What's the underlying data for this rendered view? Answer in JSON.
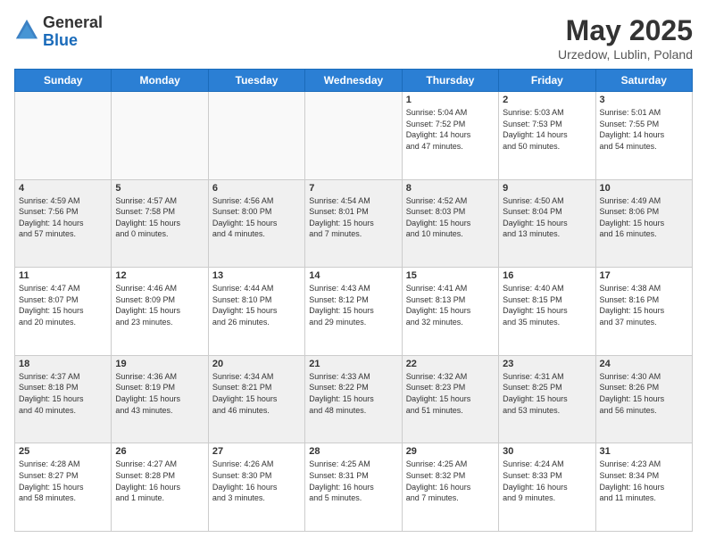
{
  "header": {
    "logo_general": "General",
    "logo_blue": "Blue",
    "month": "May 2025",
    "location": "Urzedow, Lublin, Poland"
  },
  "weekdays": [
    "Sunday",
    "Monday",
    "Tuesday",
    "Wednesday",
    "Thursday",
    "Friday",
    "Saturday"
  ],
  "weeks": [
    [
      {
        "day": "",
        "info": ""
      },
      {
        "day": "",
        "info": ""
      },
      {
        "day": "",
        "info": ""
      },
      {
        "day": "",
        "info": ""
      },
      {
        "day": "1",
        "info": "Sunrise: 5:04 AM\nSunset: 7:52 PM\nDaylight: 14 hours\nand 47 minutes."
      },
      {
        "day": "2",
        "info": "Sunrise: 5:03 AM\nSunset: 7:53 PM\nDaylight: 14 hours\nand 50 minutes."
      },
      {
        "day": "3",
        "info": "Sunrise: 5:01 AM\nSunset: 7:55 PM\nDaylight: 14 hours\nand 54 minutes."
      }
    ],
    [
      {
        "day": "4",
        "info": "Sunrise: 4:59 AM\nSunset: 7:56 PM\nDaylight: 14 hours\nand 57 minutes."
      },
      {
        "day": "5",
        "info": "Sunrise: 4:57 AM\nSunset: 7:58 PM\nDaylight: 15 hours\nand 0 minutes."
      },
      {
        "day": "6",
        "info": "Sunrise: 4:56 AM\nSunset: 8:00 PM\nDaylight: 15 hours\nand 4 minutes."
      },
      {
        "day": "7",
        "info": "Sunrise: 4:54 AM\nSunset: 8:01 PM\nDaylight: 15 hours\nand 7 minutes."
      },
      {
        "day": "8",
        "info": "Sunrise: 4:52 AM\nSunset: 8:03 PM\nDaylight: 15 hours\nand 10 minutes."
      },
      {
        "day": "9",
        "info": "Sunrise: 4:50 AM\nSunset: 8:04 PM\nDaylight: 15 hours\nand 13 minutes."
      },
      {
        "day": "10",
        "info": "Sunrise: 4:49 AM\nSunset: 8:06 PM\nDaylight: 15 hours\nand 16 minutes."
      }
    ],
    [
      {
        "day": "11",
        "info": "Sunrise: 4:47 AM\nSunset: 8:07 PM\nDaylight: 15 hours\nand 20 minutes."
      },
      {
        "day": "12",
        "info": "Sunrise: 4:46 AM\nSunset: 8:09 PM\nDaylight: 15 hours\nand 23 minutes."
      },
      {
        "day": "13",
        "info": "Sunrise: 4:44 AM\nSunset: 8:10 PM\nDaylight: 15 hours\nand 26 minutes."
      },
      {
        "day": "14",
        "info": "Sunrise: 4:43 AM\nSunset: 8:12 PM\nDaylight: 15 hours\nand 29 minutes."
      },
      {
        "day": "15",
        "info": "Sunrise: 4:41 AM\nSunset: 8:13 PM\nDaylight: 15 hours\nand 32 minutes."
      },
      {
        "day": "16",
        "info": "Sunrise: 4:40 AM\nSunset: 8:15 PM\nDaylight: 15 hours\nand 35 minutes."
      },
      {
        "day": "17",
        "info": "Sunrise: 4:38 AM\nSunset: 8:16 PM\nDaylight: 15 hours\nand 37 minutes."
      }
    ],
    [
      {
        "day": "18",
        "info": "Sunrise: 4:37 AM\nSunset: 8:18 PM\nDaylight: 15 hours\nand 40 minutes."
      },
      {
        "day": "19",
        "info": "Sunrise: 4:36 AM\nSunset: 8:19 PM\nDaylight: 15 hours\nand 43 minutes."
      },
      {
        "day": "20",
        "info": "Sunrise: 4:34 AM\nSunset: 8:21 PM\nDaylight: 15 hours\nand 46 minutes."
      },
      {
        "day": "21",
        "info": "Sunrise: 4:33 AM\nSunset: 8:22 PM\nDaylight: 15 hours\nand 48 minutes."
      },
      {
        "day": "22",
        "info": "Sunrise: 4:32 AM\nSunset: 8:23 PM\nDaylight: 15 hours\nand 51 minutes."
      },
      {
        "day": "23",
        "info": "Sunrise: 4:31 AM\nSunset: 8:25 PM\nDaylight: 15 hours\nand 53 minutes."
      },
      {
        "day": "24",
        "info": "Sunrise: 4:30 AM\nSunset: 8:26 PM\nDaylight: 15 hours\nand 56 minutes."
      }
    ],
    [
      {
        "day": "25",
        "info": "Sunrise: 4:28 AM\nSunset: 8:27 PM\nDaylight: 15 hours\nand 58 minutes."
      },
      {
        "day": "26",
        "info": "Sunrise: 4:27 AM\nSunset: 8:28 PM\nDaylight: 16 hours\nand 1 minute."
      },
      {
        "day": "27",
        "info": "Sunrise: 4:26 AM\nSunset: 8:30 PM\nDaylight: 16 hours\nand 3 minutes."
      },
      {
        "day": "28",
        "info": "Sunrise: 4:25 AM\nSunset: 8:31 PM\nDaylight: 16 hours\nand 5 minutes."
      },
      {
        "day": "29",
        "info": "Sunrise: 4:25 AM\nSunset: 8:32 PM\nDaylight: 16 hours\nand 7 minutes."
      },
      {
        "day": "30",
        "info": "Sunrise: 4:24 AM\nSunset: 8:33 PM\nDaylight: 16 hours\nand 9 minutes."
      },
      {
        "day": "31",
        "info": "Sunrise: 4:23 AM\nSunset: 8:34 PM\nDaylight: 16 hours\nand 11 minutes."
      }
    ]
  ]
}
